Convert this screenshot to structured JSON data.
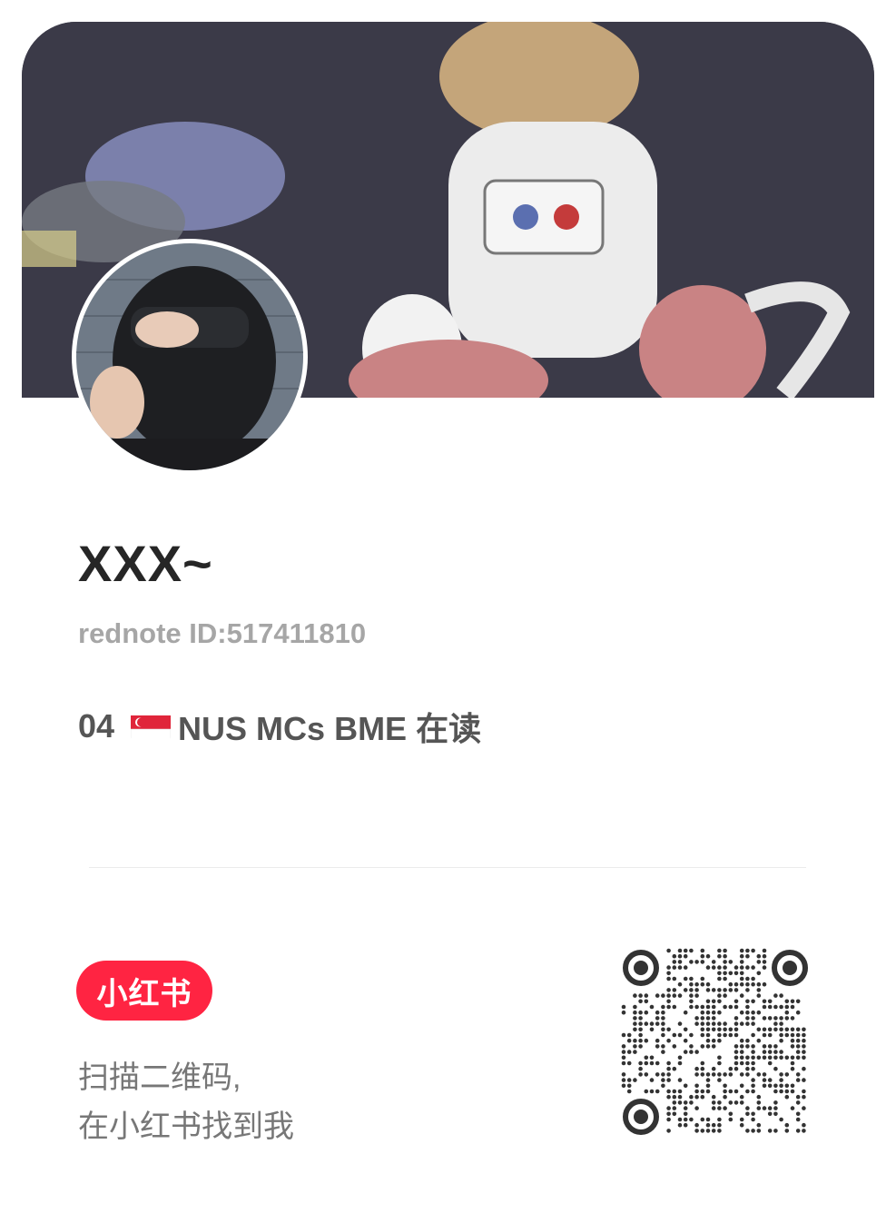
{
  "profile": {
    "username": "XXX~",
    "rednote_id": "rednote ID:517411810",
    "bio_prefix": "04",
    "bio_text": "NUS MCs BME 在读",
    "flag_icon": "singapore-flag-icon"
  },
  "footer": {
    "logo_text": "小红书",
    "scan_line1": "扫描二维码,",
    "scan_line2": "在小红书找到我"
  },
  "colors": {
    "brand": "#ff2442",
    "username": "#262626",
    "muted": "#a6a6a6",
    "bio": "#555555"
  }
}
